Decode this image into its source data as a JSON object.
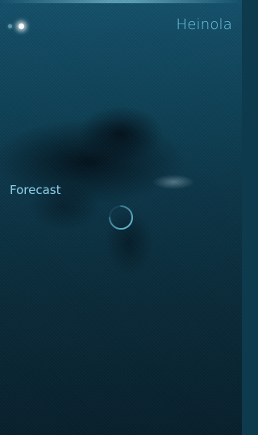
{
  "header": {
    "city_name": "Heinola",
    "pager": {
      "page_count": 2,
      "active_page": 2
    }
  },
  "main": {
    "section_title": "Forecast",
    "loading": true
  },
  "colors": {
    "accent": "#6fc9e6",
    "background_top": "#14506a",
    "background_bottom": "#07202c"
  }
}
